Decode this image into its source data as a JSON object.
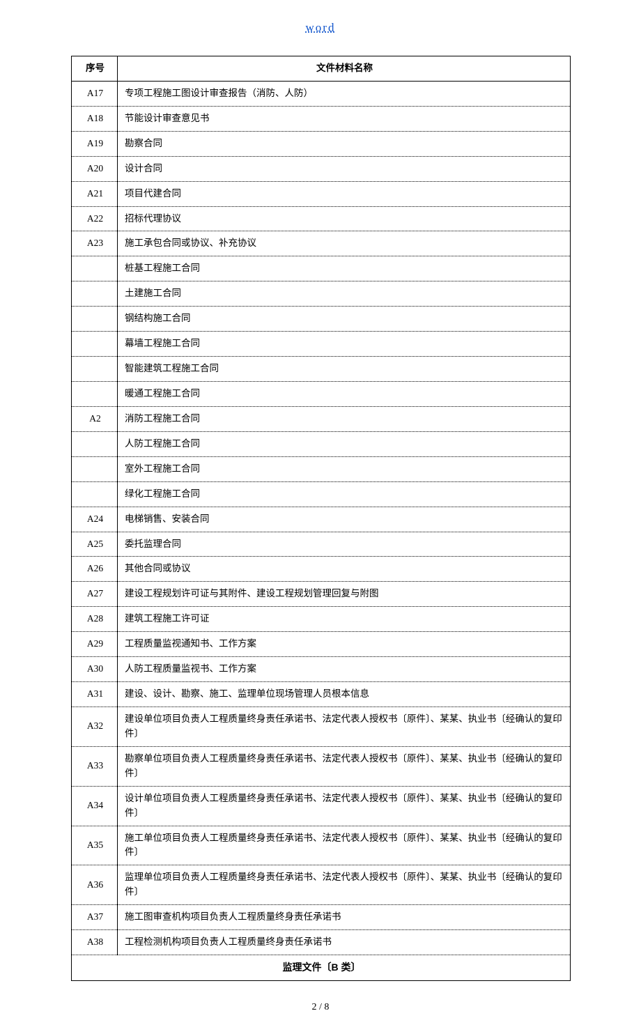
{
  "header_link": "word",
  "table": {
    "columns": {
      "id": "序号",
      "name": "文件材料名称"
    },
    "rows": [
      {
        "id": "A17",
        "name": "专项工程施工图设计审查报告（消防、人防）"
      },
      {
        "id": "A18",
        "name": "节能设计审查意见书"
      },
      {
        "id": "A19",
        "name": "勘察合同"
      },
      {
        "id": "A20",
        "name": "设计合同"
      },
      {
        "id": "A21",
        "name": "项目代建合同"
      },
      {
        "id": "A22",
        "name": "招标代理协议"
      },
      {
        "id": "A23",
        "name": "施工承包合同或协议、补充协议"
      },
      {
        "id": "",
        "name": "桩基工程施工合同"
      },
      {
        "id": "",
        "name": "土建施工合同"
      },
      {
        "id": "",
        "name": "钢结构施工合同"
      },
      {
        "id": "",
        "name": "幕墙工程施工合同"
      },
      {
        "id": "",
        "name": "智能建筑工程施工合同"
      },
      {
        "id": "",
        "name": "暖通工程施工合同"
      },
      {
        "id": "A2",
        "name": "消防工程施工合同"
      },
      {
        "id": "",
        "name": "人防工程施工合同"
      },
      {
        "id": "",
        "name": "室外工程施工合同"
      },
      {
        "id": "",
        "name": "绿化工程施工合同"
      },
      {
        "id": "A24",
        "name": "电梯销售、安装合同"
      },
      {
        "id": "A25",
        "name": "委托监理合同"
      },
      {
        "id": "A26",
        "name": "其他合同或协议"
      },
      {
        "id": "A27",
        "name": "建设工程规划许可证与其附件、建设工程规划管理回复与附图"
      },
      {
        "id": "A28",
        "name": "建筑工程施工许可证"
      },
      {
        "id": "A29",
        "name": "工程质量监视通知书、工作方案"
      },
      {
        "id": "A30",
        "name": "人防工程质量监视书、工作方案"
      },
      {
        "id": "A31",
        "name": "建设、设计、勘察、施工、监理单位现场管理人员根本信息"
      },
      {
        "id": "A32",
        "name": "建设单位项目负责人工程质量终身责任承诺书、法定代表人授权书〔原件〕、某某、执业书〔经确认的复印件〕"
      },
      {
        "id": "A33",
        "name": "勘察单位项目负责人工程质量终身责任承诺书、法定代表人授权书〔原件〕、某某、执业书〔经确认的复印件〕"
      },
      {
        "id": "A34",
        "name": "设计单位项目负责人工程质量终身责任承诺书、法定代表人授权书〔原件〕、某某、执业书〔经确认的复印件〕"
      },
      {
        "id": "A35",
        "name": "施工单位项目负责人工程质量终身责任承诺书、法定代表人授权书〔原件〕、某某、执业书〔经确认的复印件〕"
      },
      {
        "id": "A36",
        "name": "监理单位项目负责人工程质量终身责任承诺书、法定代表人授权书〔原件〕、某某、执业书〔经确认的复印件〕"
      },
      {
        "id": "A37",
        "name": "施工图审查机构项目负责人工程质量终身责任承诺书"
      },
      {
        "id": "A38",
        "name": "工程检测机构项目负责人工程质量终身责任承诺书"
      }
    ],
    "section_footer": "监理文件〔B 类〕"
  },
  "pager": "2 / 8"
}
